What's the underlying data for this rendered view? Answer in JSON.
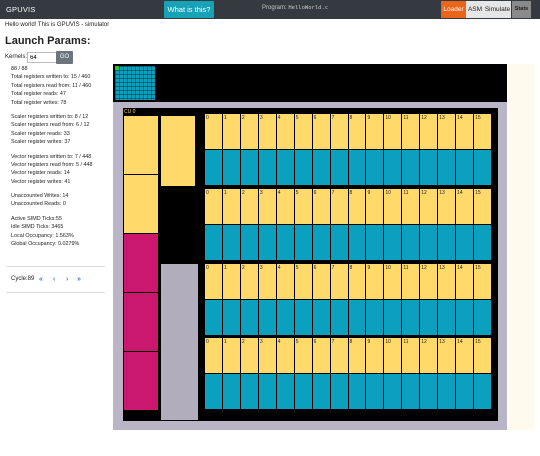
{
  "navbar": {
    "brand": "GPUVIS",
    "about_label": "What is this?",
    "program_prefix": "Program:",
    "program_file": "HelloWorld.c",
    "buttons": [
      {
        "label": "Loader",
        "bg": "#e8651b",
        "fg": "#ffffff"
      },
      {
        "label": "ASM",
        "bg": "#e6e6e6",
        "fg": "#222222"
      },
      {
        "label": "Simulate",
        "bg": "#e6e6e6",
        "fg": "#222222"
      },
      {
        "label": "Stats",
        "bg": "#8a8a8a",
        "fg": "#222222"
      }
    ]
  },
  "intro": "Hello world! This is GPUVIS - simulator",
  "launch_title": "Launch Params:",
  "kernels": {
    "label": "Kernels:",
    "value": "64"
  },
  "go_label": "GO",
  "stats": [
    [
      "88 / 88",
      "Total registers written to: 15 / 460",
      "Total registers read from: 11 / 460",
      "Total register reads: 47",
      "Total register writes: 78"
    ],
    [
      "Scaler registers written to: 8 / 12",
      "Scaler registers read from: 6 / 12",
      "Scaler register reads: 33",
      "Scaler register writes: 37"
    ],
    [
      "Vector registers written to: 7 / 448",
      "Vector registers read from: 5 / 448",
      "Vector register reads: 14",
      "Vector register writes: 41"
    ],
    [
      "Unaccounted Writes: 14",
      "Unaccounted Reads: 0"
    ],
    [
      "Active SIMD Ticks:55",
      "Idle SIMD Ticks: 3465",
      "Local Occupancy: 1.563%",
      "Global Occupancy: 0.0279%"
    ]
  ],
  "cycle": {
    "label": "Cycle:89",
    "first": "«",
    "prev": "‹",
    "next": "›",
    "last": "»"
  },
  "sim": {
    "colors": {
      "black": "#000000",
      "yellow": "#ffd96a",
      "teal": "#0ba0bd",
      "magenta": "#c9186d",
      "gray": "#b1adbc",
      "green": "#2dc23b",
      "cu_bg": "#b9b4c6"
    },
    "cu_label": "CU 0",
    "lanes": [
      "0",
      "1",
      "2",
      "3",
      "4",
      "5",
      "6",
      "7",
      "8",
      "9",
      "10",
      "11",
      "12",
      "13",
      "14",
      "15"
    ],
    "simd_count": 4
  }
}
